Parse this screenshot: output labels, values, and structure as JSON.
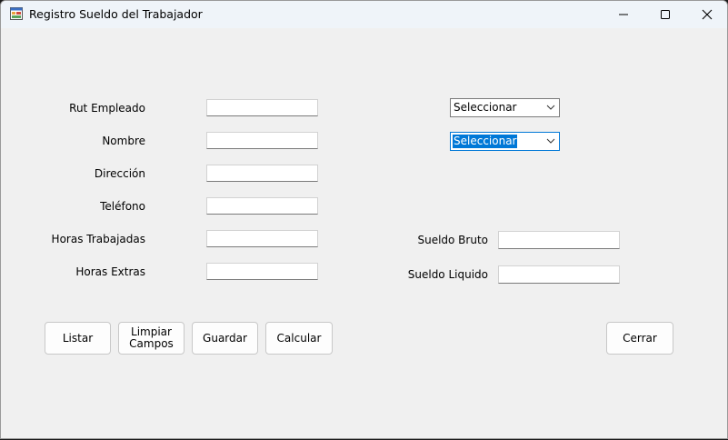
{
  "window": {
    "title": "Registro Sueldo del Trabajador",
    "controls": [
      "minimize",
      "maximize",
      "close"
    ]
  },
  "form": {
    "labels": {
      "rut": "Rut Empleado",
      "nombre": "Nombre",
      "direccion": "Dirección",
      "telefono": "Teléfono",
      "horas_trabajadas": "Horas Trabajadas",
      "horas_extras": "Horas Extras",
      "sueldo_bruto": "Sueldo Bruto",
      "sueldo_liquido": "Sueldo Liquido"
    },
    "values": {
      "rut": "",
      "nombre": "",
      "direccion": "",
      "telefono": "",
      "horas_trabajadas": "",
      "horas_extras": "",
      "sueldo_bruto": "",
      "sueldo_liquido": ""
    },
    "combos": [
      {
        "selected": "Seleccionar",
        "highlighted": false
      },
      {
        "selected": "Seleccionar",
        "highlighted": true
      }
    ]
  },
  "buttons": {
    "listar": "Listar",
    "limpiar_line1": "Limpiar",
    "limpiar_line2": "Campos",
    "guardar": "Guardar",
    "calcular": "Calcular",
    "cerrar": "Cerrar"
  },
  "colors": {
    "highlight": "#0078d7",
    "form_bg": "#f0f0f0",
    "titlebar_bg": "#eff4f9"
  }
}
